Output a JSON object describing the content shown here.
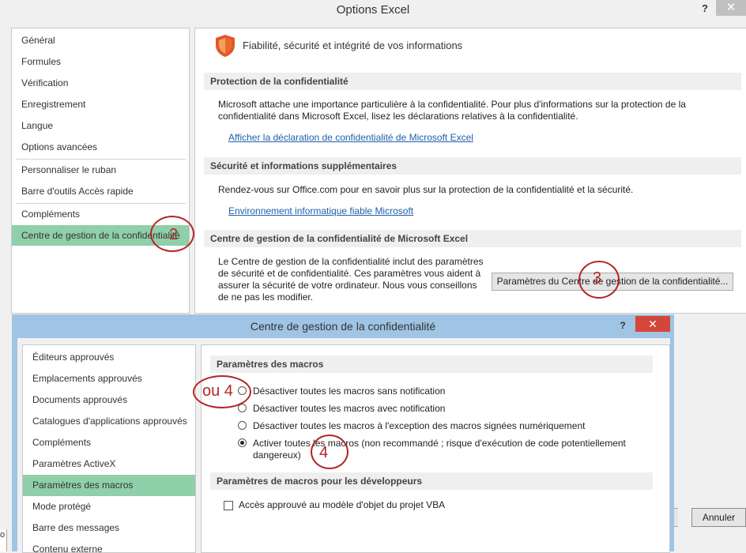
{
  "main_window": {
    "title": "Options Excel",
    "help_label": "?",
    "close_label": "✕"
  },
  "nav": [
    {
      "label": "Général"
    },
    {
      "label": "Formules"
    },
    {
      "label": "Vérification"
    },
    {
      "label": "Enregistrement"
    },
    {
      "label": "Langue"
    },
    {
      "label": "Options avancées"
    },
    {
      "label": "Personnaliser le ruban"
    },
    {
      "label": "Barre d'outils Accès rapide"
    },
    {
      "label": "Compléments"
    },
    {
      "label": "Centre de gestion de la confidentialité",
      "selected": true
    }
  ],
  "content": {
    "heading": "Fiabilité, sécurité et intégrité de vos informations",
    "privacy": {
      "title": "Protection de la confidentialité",
      "text_line1": "Microsoft attache une importance particulière à la confidentialité. Pour plus d'informations sur la protection de la",
      "text_line2": "confidentialité dans Microsoft Excel, lisez les déclarations relatives à la confidentialité.",
      "link": "Afficher la déclaration de confidentialité de Microsoft Excel"
    },
    "security": {
      "title": "Sécurité et informations supplémentaires",
      "text": "Rendez-vous sur Office.com pour en savoir plus sur la protection de la confidentialité et la sécurité.",
      "link": "Environnement informatique fiable Microsoft"
    },
    "trust_center": {
      "title": "Centre de gestion de la confidentialité de Microsoft Excel",
      "lines": [
        "Le Centre de gestion de la confidentialité inclut des paramètres",
        "de sécurité et de confidentialité. Ces paramètres vous aident à",
        "assurer la sécurité de votre ordinateur. Nous vous conseillons",
        "de ne pas les modifier."
      ],
      "button": "Paramètres du Centre de gestion de la confidentialité..."
    },
    "cancel_button": "Annuler",
    "edge_fragment": "o"
  },
  "dialog": {
    "title": "Centre de gestion de la confidentialité",
    "help_label": "?",
    "close_label": "✕",
    "nav": [
      {
        "label": "Éditeurs approuvés"
      },
      {
        "label": "Emplacements approuvés"
      },
      {
        "label": "Documents approuvés"
      },
      {
        "label": "Catalogues d'applications approuvés"
      },
      {
        "label": "Compléments"
      },
      {
        "label": "Paramètres ActiveX"
      },
      {
        "label": "Paramètres des macros",
        "selected": true
      },
      {
        "label": "Mode protégé"
      },
      {
        "label": "Barre des messages"
      },
      {
        "label": "Contenu externe"
      }
    ],
    "macro_section": "Paramètres des macros",
    "options": [
      {
        "label": "Désactiver toutes les macros sans notification",
        "checked": false
      },
      {
        "label": "Désactiver toutes les macros avec notification",
        "checked": false
      },
      {
        "label": "Désactiver toutes les macros à l'exception des macros signées numériquement",
        "checked": false
      },
      {
        "label_line1": "Activer toutes les macros (non recommandé ; risque d'exécution de code potentiellement",
        "label_line2": "dangereux)",
        "checked": true
      }
    ],
    "dev_section": "Paramètres de macros pour les développeurs",
    "vba_checkbox": "Accès approuvé au modèle d'objet du projet VBA"
  },
  "annotations": {
    "step2": "2",
    "step3": "3",
    "step4": "4",
    "step4_alt": "ou 4",
    "color": "#b52525"
  }
}
